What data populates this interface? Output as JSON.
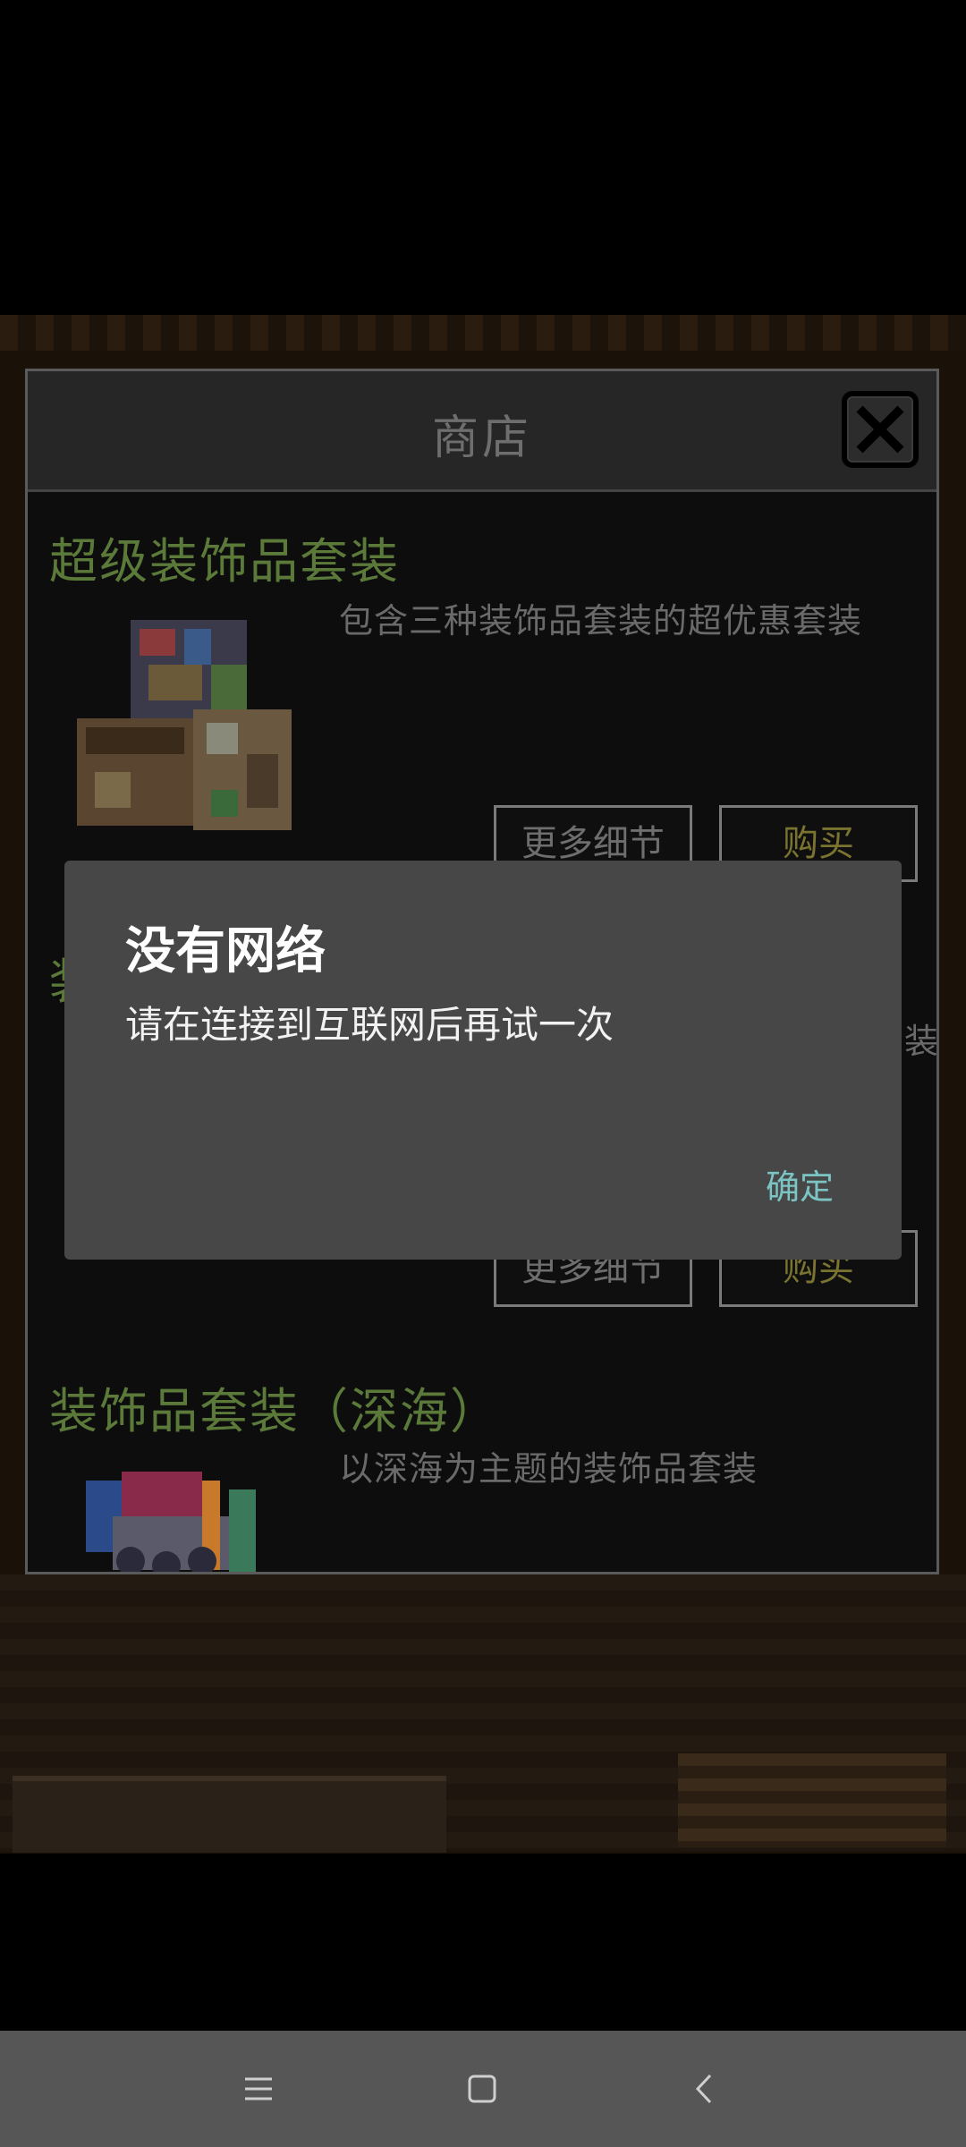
{
  "shop": {
    "title": "商店",
    "items": [
      {
        "title": "超级装饰品套装",
        "description": "包含三种装饰品套装的超优惠套装",
        "details_label": "更多细节",
        "buy_label": "购买"
      },
      {
        "title": "装",
        "description": "装",
        "details_label": "更多细节",
        "buy_label": "购买"
      },
      {
        "title": "装饰品套装（深海）",
        "description": "以深海为主题的装饰品套装"
      }
    ]
  },
  "alert": {
    "title": "没有网络",
    "message": "请在连接到互联网后再试一次",
    "ok_label": "确定"
  },
  "navbar": {
    "icons": [
      "menu-icon",
      "home-square-icon",
      "back-chevron-icon"
    ]
  },
  "colors": {
    "accent": "#7cc4c4",
    "item_title": "#5b7a3a",
    "dialog_bg": "#474747"
  }
}
